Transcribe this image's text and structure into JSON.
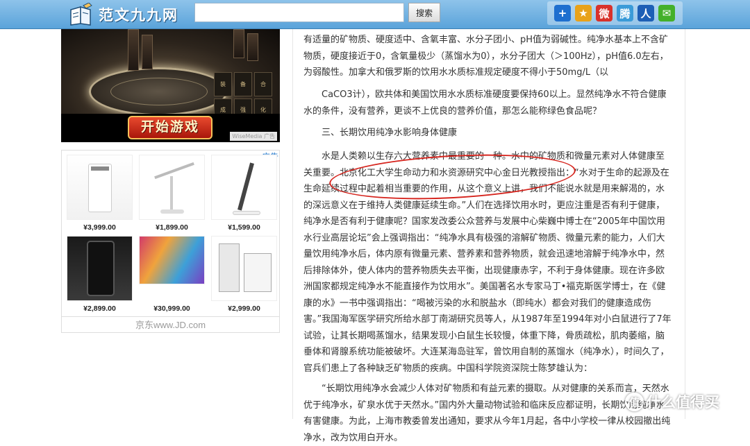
{
  "header": {
    "site_name": "范文九九网",
    "search_value": "",
    "search_button": "搜索",
    "share_icons": [
      {
        "icon": "plus-icon",
        "glyph": "+",
        "color": "#1e6fcf"
      },
      {
        "icon": "star-icon",
        "glyph": "★",
        "color": "#e8a21a"
      },
      {
        "icon": "weibo-icon",
        "glyph": "微",
        "color": "#d8322b"
      },
      {
        "icon": "tencent-weibo-icon",
        "glyph": "腾",
        "color": "#3a9bd8"
      },
      {
        "icon": "renren-icon",
        "glyph": "人",
        "color": "#1d5fb6"
      },
      {
        "icon": "wechat-icon",
        "glyph": "✉",
        "color": "#44b02a"
      }
    ]
  },
  "game_ad": {
    "start_button": "开始游戏",
    "watermark": "WiseMedia",
    "ad_tag": "广告",
    "item_labels": [
      "装",
      "备",
      "合",
      "成",
      "强",
      "化"
    ]
  },
  "jd_ad": {
    "ad_tag": "广告",
    "products": [
      {
        "price": "¥3,999.00"
      },
      {
        "price": "¥1,899.00"
      },
      {
        "price": "¥1,599.00"
      },
      {
        "price": "¥2,899.00"
      },
      {
        "price": "¥30,999.00"
      },
      {
        "price": "¥2,999.00"
      }
    ],
    "footer": "京东www.JD.com"
  },
  "article": {
    "p1": "有适量的矿物质、硬度适中、含氧丰富、水分子团小、pH值为弱碱性。纯净水基本上不含矿物质，硬度接近于0，含氧量极少（蒸馏水为0），水分子团大（＞100Hz），pH值6.0左右，为弱酸性。加拿大和俄罗斯的饮用水水质标准规定硬度不得小于50mg/L（以",
    "p2": "CaCO3计），欧共体和美国饮用水水质标准硬度要保持60以上。显然纯净水不符合健康水的条件，没有营养，更谈不上优良的营养价值，那怎么能称绿色食品呢？",
    "heading3": "三、长期饮用纯净水影响身体健康",
    "p3": "水是人类赖以生存六大营养素中最重要的一种。水中的矿物质和微量元素对人体健康至关重要。北京化工大学生命动力和水资源研究中心金日光教授指出：“水对于生命的起源及在生命延续过程中起着相当重要的作用，从这个意义上讲，我们不能说水就是用来解渴的，水的深远意义在于维持人类健康延续生命。”人们在选择饮用水时，更应注重是否有利于健康，纯净水是否有利于健康呢？国家发改委公众营养与发展中心柴巍中博士在“2005年中国饮用水行业高层论坛”会上强调指出：“纯净水具有极强的溶解矿物质、微量元素的能力，人们大量饮用纯净水后，体内原有微量元素、营养素和营养物质，就会迅速地溶解于纯净水中，然后排除体外，使人体内的营养物质失去平衡，出现健康赤字，不利于身体健康。现在许多欧洲国家都规定纯净水不能直接作为饮用水”。美国著名水专家马丁•福克斯医学博士，在《健康的水》一书中强调指出：“喝被污染的水和脱盐水（即纯水）都会对我们的健康造成伤害。”我国海军医学研究所给水部丁南湖研究员等人，从1987年至1994年对小白鼠进行了7年试验，让其长期喝蒸馏水，结果发现小白鼠生长较慢，体重下降，骨质疏松，肌肉萎缩，脑垂体和肾腺系统功能被破坏。大连某海岛驻军，曾饮用自制的蒸馏水（纯净水），时间久了，官兵们患上了各种缺乏矿物质的疾病。中国科学院资深院士陈梦雄认为：",
    "p4": "“长期饮用纯净水会减少人体对矿物质和有益元素的摄取。从对健康的关系而言，天然水优于纯净水，矿泉水优于天然水。”国内外大量动物试验和临床反应都证明，长期饮用纯净水有害健康。为此，上海市教委曾发出通知，要求从今年1月起，各中小学校一律从校园撤出纯净水，改为饮用白开水。"
  },
  "watermark": {
    "glyph": "值",
    "text": "什么值得买"
  }
}
